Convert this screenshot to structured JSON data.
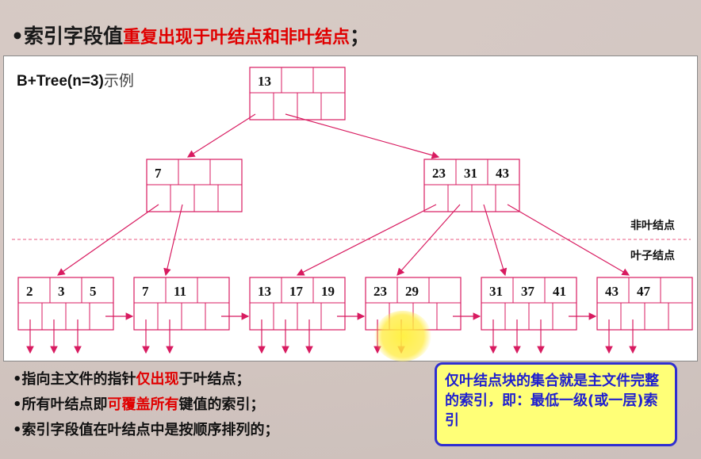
{
  "headline": {
    "bullet": "•",
    "plain": "索引字段值",
    "red": "重复出现于叶结点和非叶结点",
    "tail": "；"
  },
  "diagram": {
    "title": "B+Tree(n=3)",
    "title_suffix": "示例",
    "label_nonleaf": "非叶结点",
    "label_leaf": "叶子结点",
    "root": [
      "13",
      "",
      ""
    ],
    "level1": [
      [
        "7",
        "",
        ""
      ],
      [
        "23",
        "31",
        "43"
      ]
    ],
    "leaves": [
      [
        "2",
        "3",
        "5"
      ],
      [
        "7",
        "11",
        ""
      ],
      [
        "13",
        "17",
        "19"
      ],
      [
        "23",
        "29",
        ""
      ],
      [
        "31",
        "37",
        "41"
      ],
      [
        "43",
        "47",
        ""
      ]
    ],
    "colors": {
      "node_border": "#d81b60",
      "arrow": "#d81b60",
      "divider": "#e85a80"
    }
  },
  "bullets": [
    {
      "pre": "•指向主文件的指针",
      "red": "仅出现",
      "post": "于叶结点；"
    },
    {
      "pre": "•所有叶结点即",
      "red": "可覆盖所有",
      "post": "键值的索引；"
    },
    {
      "pre": "•索引字段值在叶结点中是按顺序排列的；",
      "red": "",
      "post": ""
    }
  ],
  "callout": {
    "text": "仅叶结点块的集合就是主文件完整的索引，即：最低一级(或一层)索引"
  }
}
